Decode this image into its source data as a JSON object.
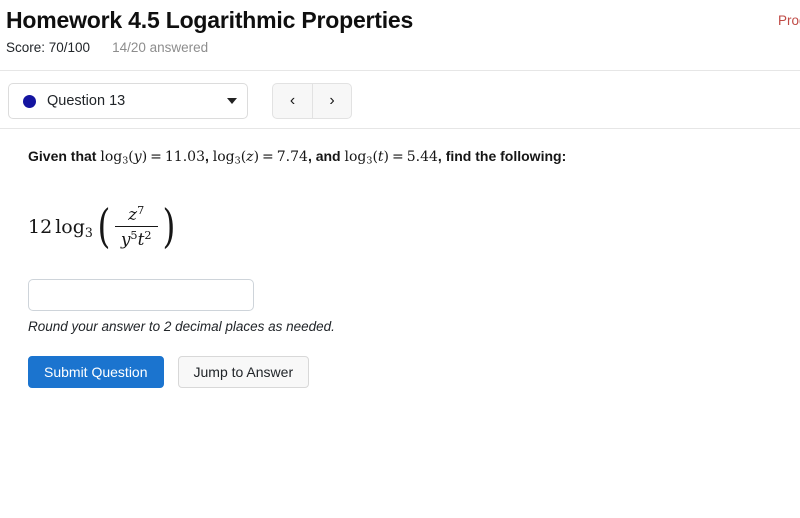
{
  "header": {
    "title": "Homework 4.5 Logarithmic Properties",
    "score_label": "Score: 70/100",
    "answered_label": "14/20 answered",
    "progress_note": "Progress saved"
  },
  "question_bar": {
    "selected_question": "Question 13",
    "dot_color": "#1414a0",
    "caret_icon": "chevron-down-icon",
    "prev_label": "‹",
    "next_label": "›"
  },
  "problem": {
    "given_prefix": "Given that ",
    "given_terms": [
      {
        "log_base": "3",
        "arg": "y",
        "value": "11.03",
        "separator": ", "
      },
      {
        "log_base": "3",
        "arg": "z",
        "value": "7.74",
        "separator": ", and "
      },
      {
        "log_base": "3",
        "arg": "t",
        "value": "5.44",
        "separator": ", "
      }
    ],
    "given_suffix": "find the following:",
    "expression": {
      "coefficient": "12",
      "log_name": "log",
      "log_base": "3",
      "numerator_base": "z",
      "numerator_exp": "7",
      "denominator": [
        {
          "base": "y",
          "exp": "5"
        },
        {
          "base": "t",
          "exp": "2"
        }
      ],
      "plain_text": "12 log_3( z^7 / (y^5 t^2) )"
    }
  },
  "answer": {
    "value": "",
    "placeholder": "",
    "hint": "Round your answer to 2 decimal places as needed."
  },
  "actions": {
    "submit_label": "Submit Question",
    "jump_label": "Jump to Answer",
    "primary_color": "#1b74cf"
  }
}
